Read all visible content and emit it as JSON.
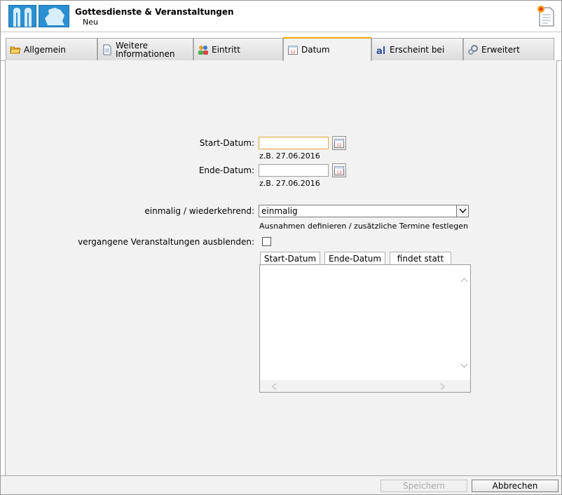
{
  "header": {
    "title": "Gottesdienste & Veranstaltungen",
    "subtitle": "Neu"
  },
  "tabs": [
    {
      "label": "Allgemein",
      "icon": "folder-icon"
    },
    {
      "label": "Weitere Informationen",
      "icon": "document-icon"
    },
    {
      "label": "Eintritt",
      "icon": "people-icon"
    },
    {
      "label": "Datum",
      "icon": "calendar-icon",
      "active": true
    },
    {
      "label": "Erscheint bei",
      "icon": "text-a-icon"
    },
    {
      "label": "Erweitert",
      "icon": "gear-icon"
    }
  ],
  "form": {
    "start_date_label": "Start-Datum:",
    "start_date_value": "",
    "start_date_hint": "z.B. 27.06.2016",
    "end_date_label": "Ende-Datum:",
    "end_date_value": "",
    "end_date_hint": "z.B. 27.06.2016",
    "recurrence_label": "einmalig / wiederkehrend:",
    "recurrence_value": "einmalig",
    "exceptions_link": "Ausnahmen definieren / zusätzliche Termine festlegen",
    "hide_past_label": "vergangene Veranstaltungen ausblenden:",
    "hide_past_checked": false
  },
  "table": {
    "columns": [
      "Start-Datum",
      "Ende-Datum",
      "findet statt"
    ],
    "rows": []
  },
  "footer": {
    "save_label": "Speichern",
    "cancel_label": "Abbrechen"
  },
  "colors": {
    "active_tab_accent": "#f2a900",
    "focus_border": "#e8a23a",
    "panel_bg": "#f2f2f2",
    "logo_blue": "#2a90d2"
  }
}
